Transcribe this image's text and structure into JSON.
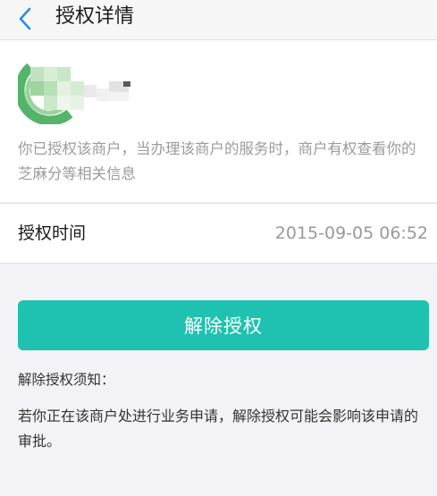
{
  "nav": {
    "title": "授权详情",
    "back_icon": "chevron-left-icon"
  },
  "merchant": {
    "logo_icon": "merchant-logo-blurred",
    "description": "你已授权该商户，当办理该商户的服务时，商户有权查看你的芝麻分等相关信息"
  },
  "auth_time": {
    "label": "授权时间",
    "value": "2015-09-05 06:52"
  },
  "actions": {
    "revoke_label": "解除授权"
  },
  "notice": {
    "title": "解除授权须知：",
    "body": "若你正在该商户处进行业务申请，解除授权可能会影响该申请的审批。"
  },
  "colors": {
    "accent": "#1fc2b0",
    "back_icon": "#2a8ee0",
    "page_background": "#f3f3f7",
    "muted_text": "#9c9c9c"
  }
}
